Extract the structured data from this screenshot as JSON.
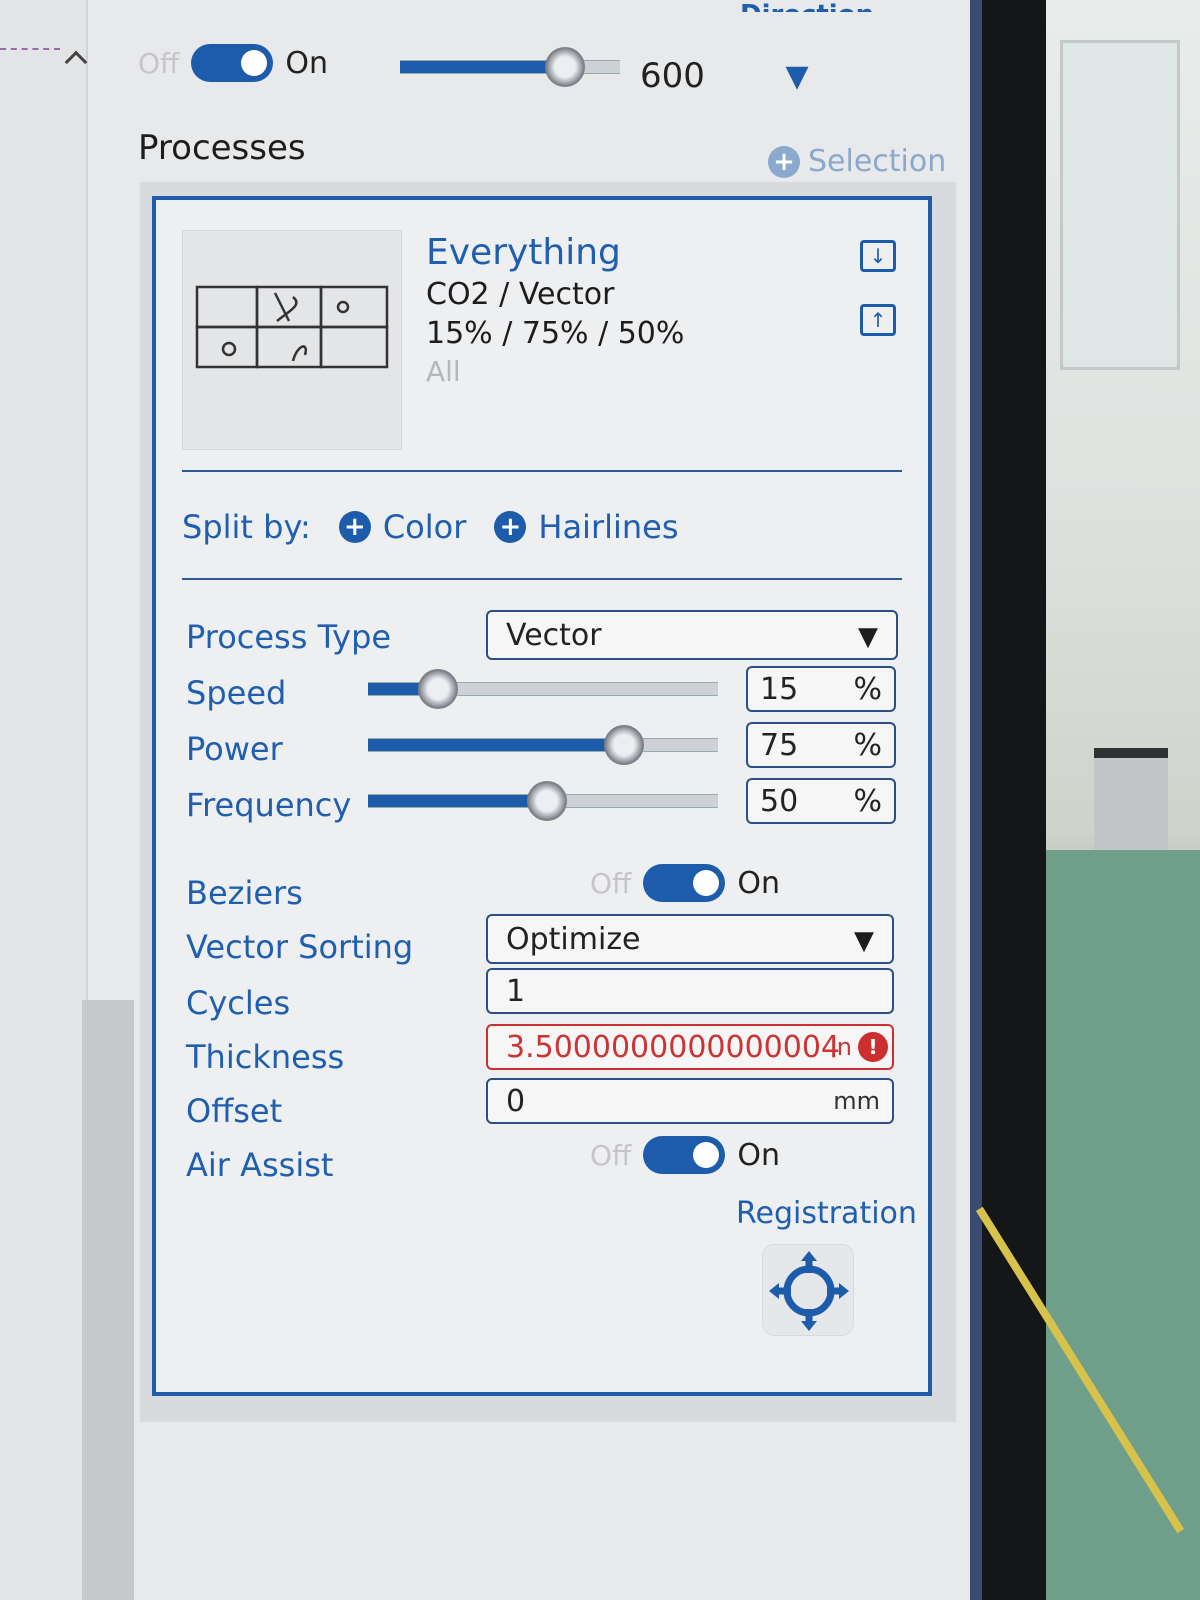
{
  "top": {
    "off_label": "Off",
    "on_label": "On",
    "speed_value": "600",
    "direction_label": "Direction",
    "direction_icon": "double-chevron-down-icon"
  },
  "processes": {
    "title": "Processes",
    "add_selection_label": "Selection"
  },
  "process": {
    "name": "Everything",
    "laser_type": "CO2 / Vector",
    "settings_summary": "15% / 75% / 50%",
    "scope": "All",
    "icons": [
      "import-icon",
      "export-icon"
    ]
  },
  "split": {
    "label": "Split by:",
    "options": [
      "Color",
      "Hairlines"
    ]
  },
  "params": {
    "process_type": {
      "label": "Process Type",
      "value": "Vector"
    },
    "speed": {
      "label": "Speed",
      "value": "15",
      "unit": "%"
    },
    "power": {
      "label": "Power",
      "value": "75",
      "unit": "%"
    },
    "frequency": {
      "label": "Frequency",
      "value": "50",
      "unit": "%"
    },
    "beziers": {
      "label": "Beziers",
      "off": "Off",
      "on": "On"
    },
    "vector_sorting": {
      "label": "Vector Sorting",
      "value": "Optimize"
    },
    "cycles": {
      "label": "Cycles",
      "value": "1"
    },
    "thickness": {
      "label": "Thickness",
      "value": "3.5000000000000004",
      "unit": "n"
    },
    "offset": {
      "label": "Offset",
      "value": "0",
      "unit": "mm"
    },
    "air_assist": {
      "label": "Air Assist",
      "off": "Off",
      "on": "On"
    },
    "registration": {
      "label": "Registration",
      "icon": "crosshair-icon"
    }
  },
  "slider_levels": {
    "top_speed": 0.75,
    "speed": 0.2,
    "power": 0.73,
    "frequency": 0.51
  },
  "colors": {
    "accent": "#1d5cab",
    "label": "#1f5fae",
    "error": "#cc2f2f"
  }
}
